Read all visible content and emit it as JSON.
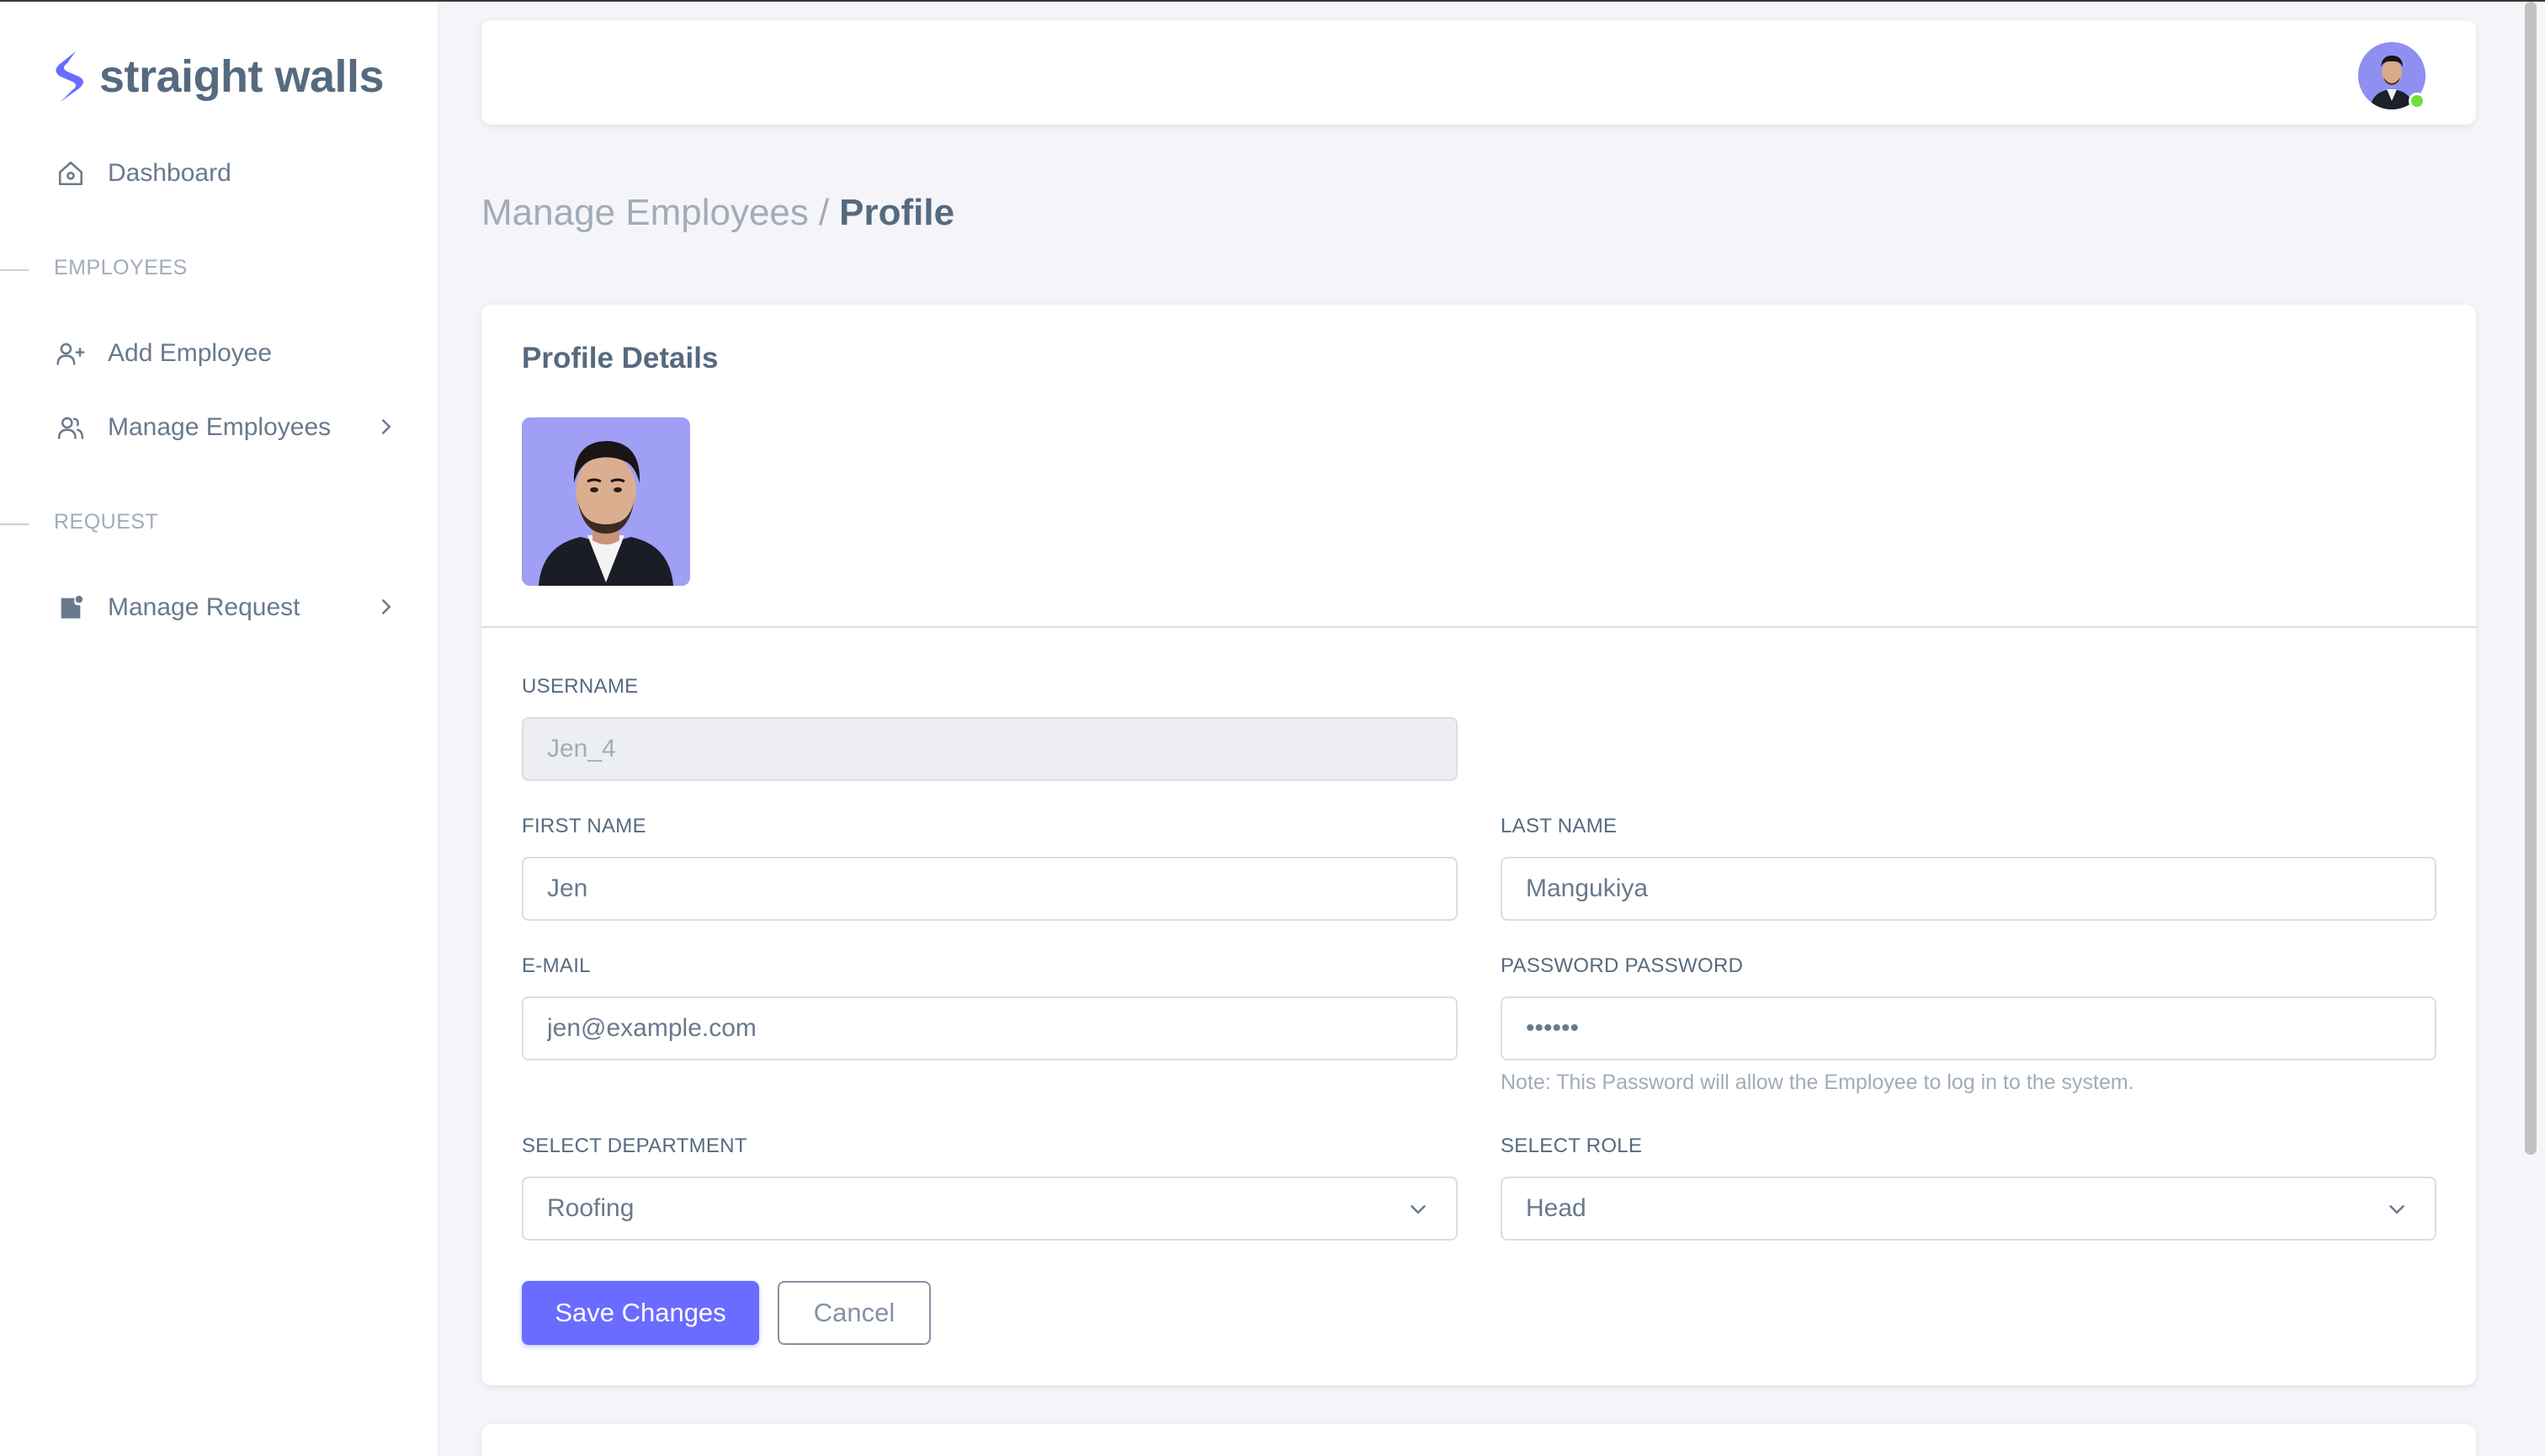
{
  "brand": {
    "name": "straight walls"
  },
  "sidebar": {
    "dashboard": "Dashboard",
    "section_employees": "EMPLOYEES",
    "add_employee": "Add Employee",
    "manage_employees": "Manage Employees",
    "section_request": "REQUEST",
    "manage_request": "Manage Request"
  },
  "breadcrumb": {
    "parent": "Manage Employees",
    "separator": "/",
    "current": "Profile"
  },
  "card": {
    "title": "Profile Details"
  },
  "form": {
    "username_label": "USERNAME",
    "username_value": "Jen_4",
    "first_name_label": "FIRST NAME",
    "first_name_value": "Jen",
    "last_name_label": "LAST NAME",
    "last_name_value": "Mangukiya",
    "email_label": "E-MAIL",
    "email_value": "jen@example.com",
    "password_label": "PASSWORD PASSWORD",
    "password_value": "••••••",
    "password_note": "Note: This Password will allow the Employee to log in to the system.",
    "department_label": "SELECT DEPARTMENT",
    "department_value": "Roofing",
    "role_label": "SELECT ROLE",
    "role_value": "Head"
  },
  "buttons": {
    "save": "Save Changes",
    "cancel": "Cancel"
  },
  "colors": {
    "primary": "#696cff",
    "text": "#566a7f",
    "muted": "#a1acb8",
    "online": "#71dd37"
  }
}
